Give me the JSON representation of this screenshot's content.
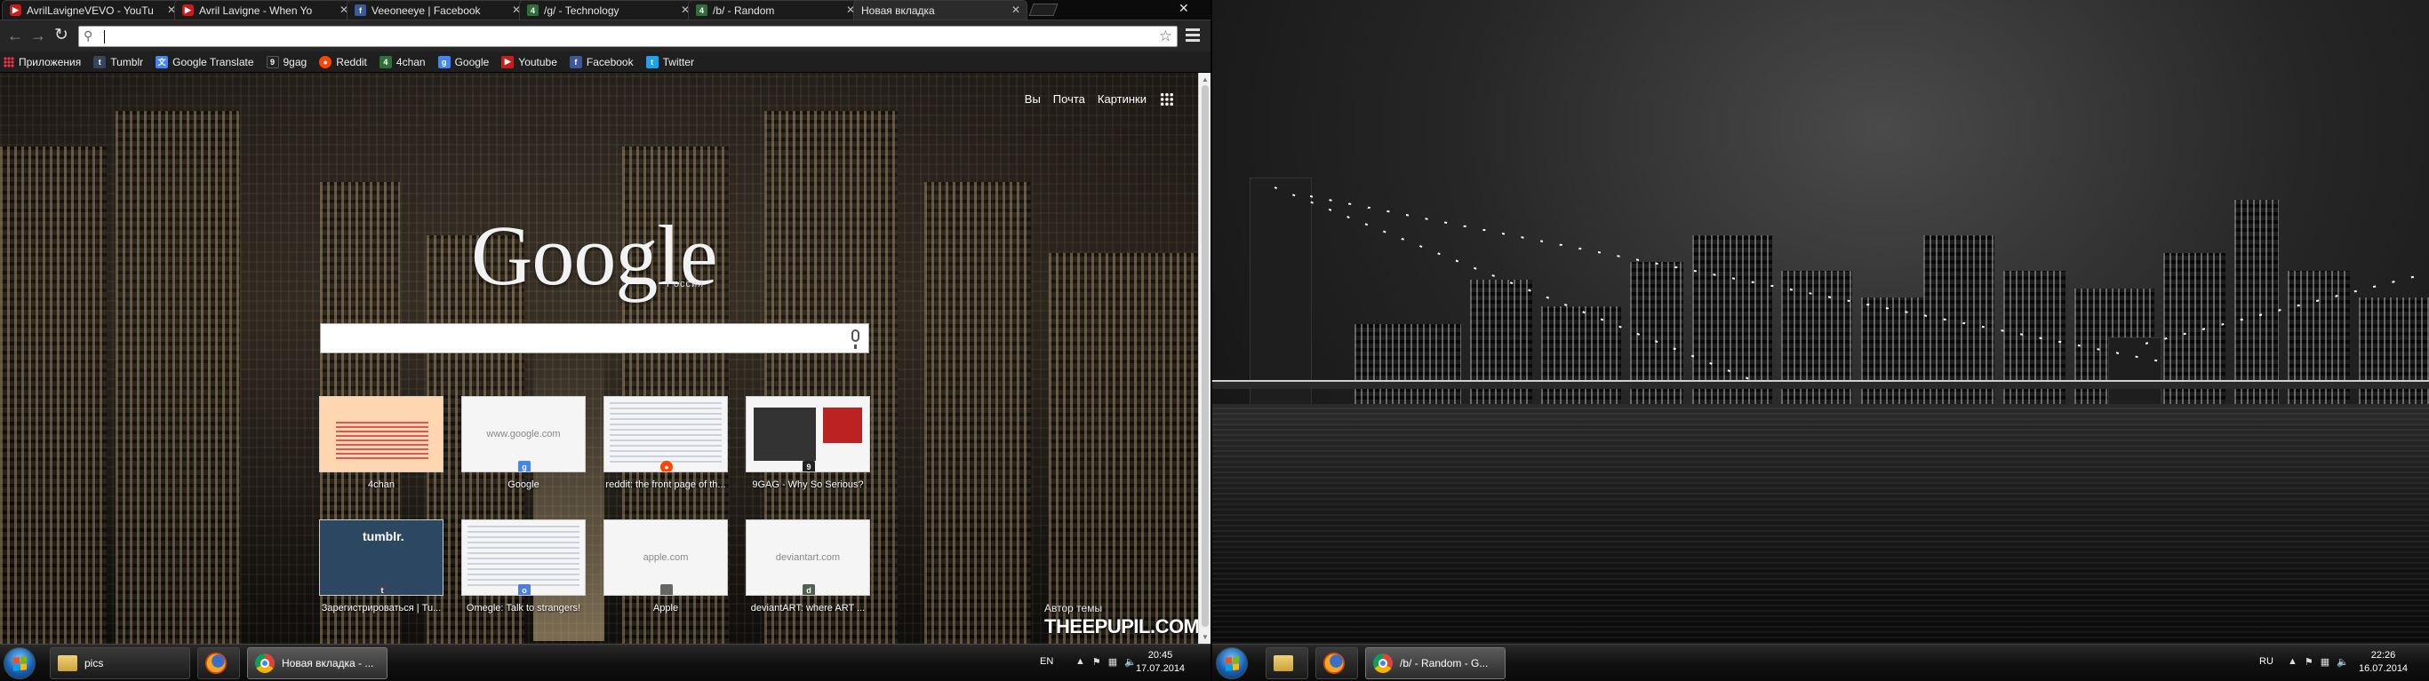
{
  "left_monitor": {
    "tabs": [
      {
        "title": "AvrilLavigneVEVO - YouTu",
        "favicon": "youtube-icon",
        "active": false
      },
      {
        "title": "Avril Lavigne - When Yo",
        "favicon": "youtube-icon",
        "active": false
      },
      {
        "title": "Veeoneeye | Facebook",
        "favicon": "facebook-icon",
        "active": false
      },
      {
        "title": "/g/ - Technology",
        "favicon": "4chan-icon",
        "active": false
      },
      {
        "title": "/b/ - Random",
        "favicon": "4chan-icon",
        "active": false
      },
      {
        "title": "Новая вкладка",
        "favicon": "",
        "active": true
      }
    ],
    "window_close": "✕",
    "toolbar": {
      "back": "←",
      "forward": "→",
      "reload": "↻",
      "omnibox_value": "",
      "star": "☆"
    },
    "bookmarks": [
      {
        "label": "Приложения",
        "icon": "apps-grid-icon",
        "color": "#e34a2f"
      },
      {
        "label": "Tumblr",
        "icon": "tumblr-icon",
        "color": "#35465c"
      },
      {
        "label": "Google Translate",
        "icon": "translate-icon",
        "color": "#4285f4"
      },
      {
        "label": "9gag",
        "icon": "9gag-icon",
        "color": "#222222"
      },
      {
        "label": "Reddit",
        "icon": "reddit-icon",
        "color": "#ff4500"
      },
      {
        "label": "4chan",
        "icon": "4chan-icon",
        "color": "#2f6f3a"
      },
      {
        "label": "Google",
        "icon": "google-icon",
        "color": "#4285f4"
      },
      {
        "label": "Youtube",
        "icon": "youtube-icon",
        "color": "#cc1b1b"
      },
      {
        "label": "Facebook",
        "icon": "facebook-icon",
        "color": "#3b5998"
      },
      {
        "label": "Twitter",
        "icon": "twitter-icon",
        "color": "#1da1f2"
      }
    ],
    "ntp": {
      "top_links": [
        "Вы",
        "Почта",
        "Картинки"
      ],
      "logo": "Google",
      "logo_sub": "Россия",
      "search_value": "",
      "tiles": [
        {
          "caption": "4chan",
          "domain": "",
          "favicon": "4chan-icon"
        },
        {
          "caption": "Google",
          "domain": "www.google.com",
          "favicon": "google-icon"
        },
        {
          "caption": "reddit: the front page of th...",
          "domain": "",
          "favicon": "reddit-icon"
        },
        {
          "caption": "9GAG - Why So Serious?",
          "domain": "",
          "favicon": "9gag-icon"
        },
        {
          "caption": "Зарегистрироваться | Tu...",
          "domain": "",
          "favicon": "tumblr-icon"
        },
        {
          "caption": "Omegle: Talk to strangers!",
          "domain": "",
          "favicon": "omegle-icon"
        },
        {
          "caption": "Apple",
          "domain": "apple.com",
          "favicon": "apple-icon"
        },
        {
          "caption": "deviantART: where ART ...",
          "domain": "deviantart.com",
          "favicon": "deviantart-icon"
        }
      ],
      "credit_label": "Автор темы",
      "credit_brand": "THEEPUPIL.COM"
    },
    "taskbar": {
      "buttons": [
        {
          "label": "pics",
          "icon": "folder-icon"
        },
        {
          "label": "",
          "icon": "firefox-icon"
        },
        {
          "label": "Новая вкладка - ...",
          "icon": "chrome-icon"
        }
      ],
      "lang": "EN",
      "time": "20:45",
      "date": "17.07.2014"
    }
  },
  "right_monitor": {
    "taskbar": {
      "buttons": [
        {
          "label": "",
          "icon": "folder-icon"
        },
        {
          "label": "",
          "icon": "firefox-icon"
        },
        {
          "label": "/b/ - Random - G...",
          "icon": "chrome-icon"
        }
      ],
      "lang": "RU",
      "time": "22:26",
      "date": "16.07.2014"
    }
  }
}
